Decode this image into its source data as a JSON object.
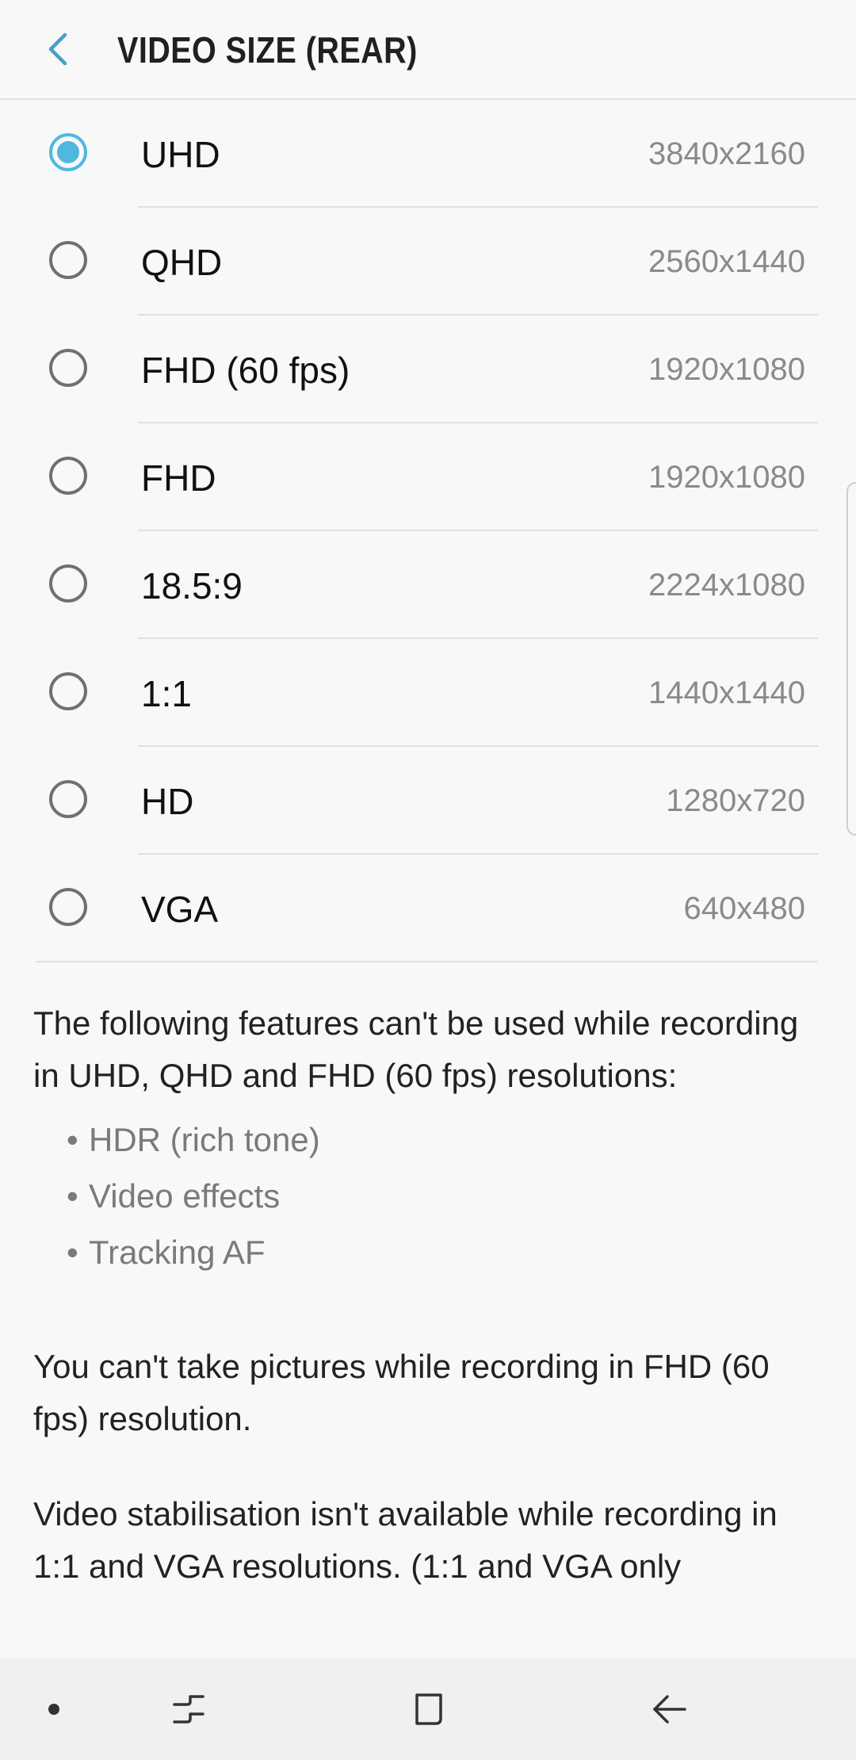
{
  "header": {
    "title": "VIDEO SIZE (REAR)",
    "back_icon": "chevron-left-icon",
    "accent_color": "#4fb8df"
  },
  "options": [
    {
      "label": "UHD",
      "resolution": "3840x2160",
      "selected": true
    },
    {
      "label": "QHD",
      "resolution": "2560x1440",
      "selected": false
    },
    {
      "label": "FHD (60 fps)",
      "resolution": "1920x1080",
      "selected": false
    },
    {
      "label": "FHD",
      "resolution": "1920x1080",
      "selected": false
    },
    {
      "label": "18.5:9",
      "resolution": "2224x1080",
      "selected": false
    },
    {
      "label": "1:1",
      "resolution": "1440x1440",
      "selected": false
    },
    {
      "label": "HD",
      "resolution": "1280x720",
      "selected": false
    },
    {
      "label": "VGA",
      "resolution": "640x480",
      "selected": false
    }
  ],
  "info": {
    "para1": "The following features can't be used while recording in UHD, QHD and FHD (60 fps) resolutions:",
    "bullets": [
      "HDR (rich tone)",
      "Video effects",
      "Tracking AF"
    ],
    "para2": "You can't take pictures while recording in FHD (60 fps) resolution.",
    "para3": "Video stabilisation isn't available while recording in 1:1 and VGA resolutions. (1:1 and VGA only"
  },
  "navbar": {
    "icons": [
      "dot-icon",
      "recent-apps-icon",
      "home-icon",
      "back-arrow-icon"
    ]
  }
}
